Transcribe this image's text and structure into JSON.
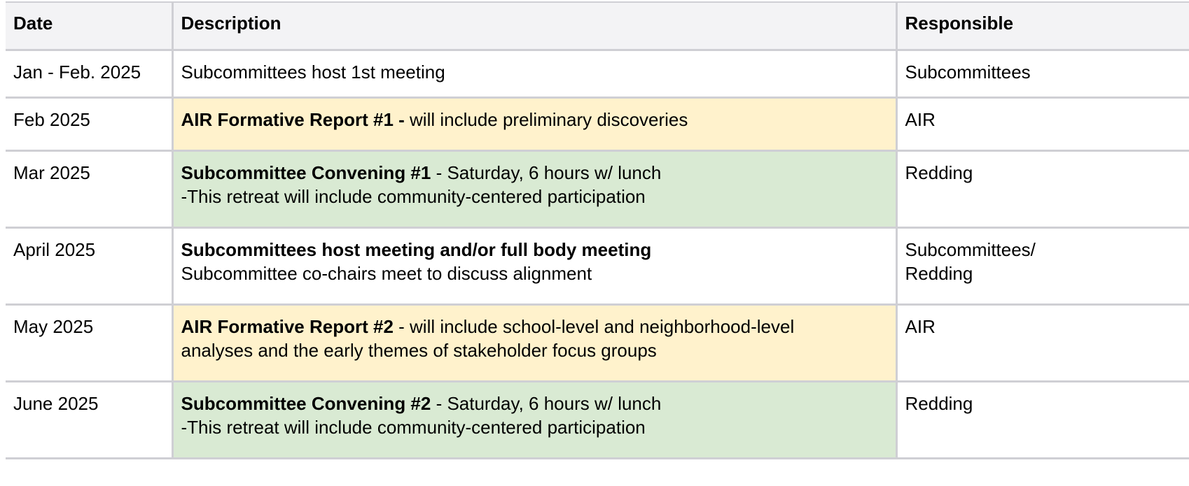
{
  "table": {
    "headers": {
      "date": "Date",
      "description": "Description",
      "responsible": "Responsible"
    },
    "rows": [
      {
        "date": "Jan - Feb. 2025",
        "tone": "",
        "desc": {
          "bold": "",
          "rest": "Subcommittees host 1st meeting",
          "line2": ""
        },
        "resp1": "Subcommittees",
        "resp2": ""
      },
      {
        "date": "Feb 2025",
        "tone": "yellow",
        "desc": {
          "bold": "AIR Formative Report #1 -",
          "rest": " will include preliminary discoveries",
          "line2": ""
        },
        "resp1": "AIR",
        "resp2": ""
      },
      {
        "date": "Mar 2025",
        "tone": "green",
        "desc": {
          "bold": "Subcommittee Convening #1",
          "rest": " - Saturday, 6 hours w/ lunch",
          "line2": "-This retreat will include community-centered participation"
        },
        "resp1": "Redding",
        "resp2": ""
      },
      {
        "date": "April 2025",
        "tone": "",
        "desc": {
          "bold": "Subcommittees host meeting and/or full body meeting",
          "rest": "",
          "line2": "Subcommittee co-chairs meet to discuss alignment"
        },
        "resp1": "Subcommittees/",
        "resp2": "Redding"
      },
      {
        "date": "May 2025",
        "tone": "yellow",
        "desc": {
          "bold": "AIR Formative Report #2",
          "rest": " -  will include school-level and neighborhood-level",
          "line2": "analyses and the early themes of stakeholder focus groups"
        },
        "resp1": "AIR",
        "resp2": ""
      },
      {
        "date": "June 2025",
        "tone": "green",
        "desc": {
          "bold": "Subcommittee Convening #2",
          "rest": " - Saturday, 6 hours w/ lunch",
          "line2": "-This retreat will include community-centered participation"
        },
        "resp1": "Redding",
        "resp2": ""
      }
    ]
  },
  "colors": {
    "header_background": "#f3f3f5",
    "grid_border": "#cfcfd4",
    "report_highlight": "#fff2cc",
    "convening_highlight": "#d9ead3"
  }
}
